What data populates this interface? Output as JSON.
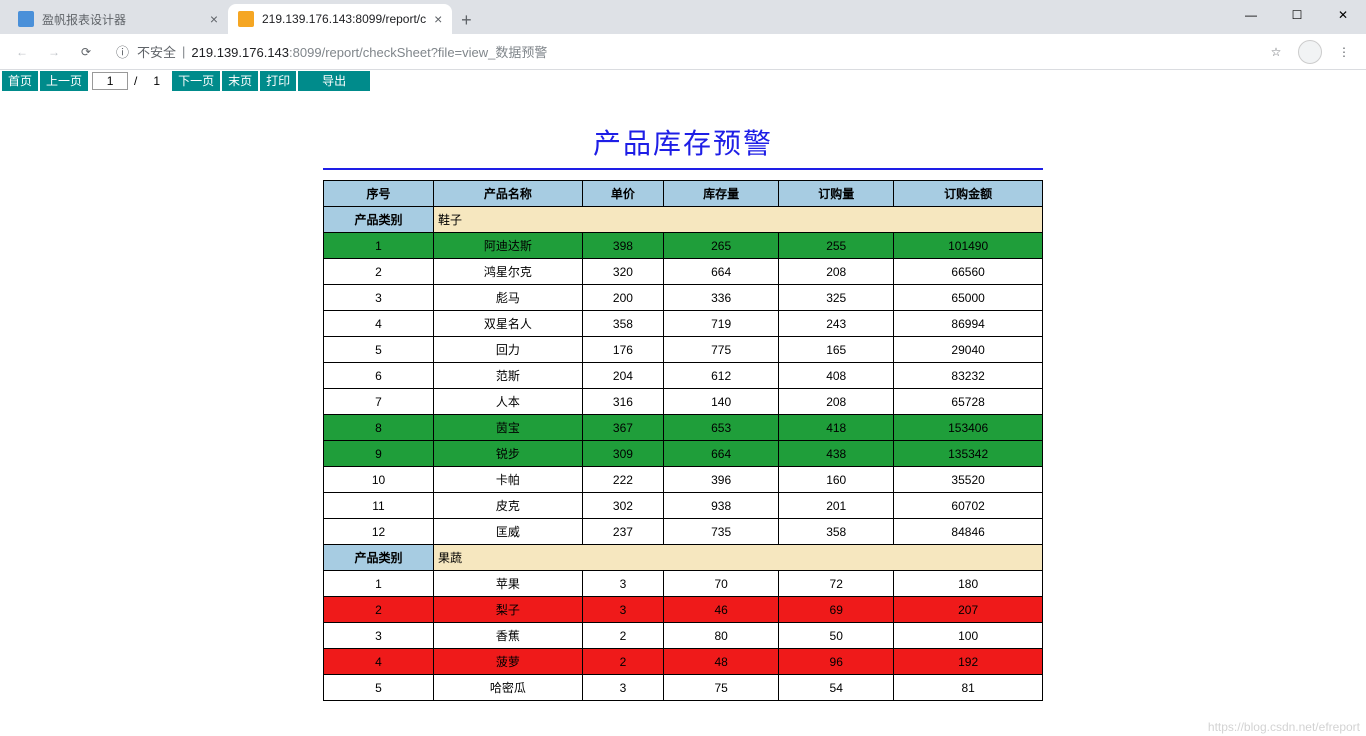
{
  "browser": {
    "tabs": [
      {
        "title": "盈帆报表设计器",
        "active": false
      },
      {
        "title": "219.139.176.143:8099/report/c",
        "active": true
      }
    ],
    "url_insecure_label": "不安全",
    "url_host": "219.139.176.143",
    "url_port": ":8099",
    "url_path": "/report/checkSheet?file=view_数据预警"
  },
  "toolbar": {
    "first": "首页",
    "prev": "上一页",
    "current_page": "1",
    "total_pages": "1",
    "next": "下一页",
    "last": "末页",
    "print": "打印",
    "export": "导出"
  },
  "report": {
    "title": "产品库存预警",
    "columns": [
      "序号",
      "产品名称",
      "单价",
      "库存量",
      "订购量",
      "订购金额"
    ],
    "category_label": "产品类别",
    "groups": [
      {
        "category": "鞋子",
        "rows": [
          {
            "seq": "1",
            "name": "阿迪达斯",
            "price": "398",
            "stock": "265",
            "order": "255",
            "amount": "101490",
            "hl": "green"
          },
          {
            "seq": "2",
            "name": "鸿星尔克",
            "price": "320",
            "stock": "664",
            "order": "208",
            "amount": "66560",
            "hl": ""
          },
          {
            "seq": "3",
            "name": "彪马",
            "price": "200",
            "stock": "336",
            "order": "325",
            "amount": "65000",
            "hl": ""
          },
          {
            "seq": "4",
            "name": "双星名人",
            "price": "358",
            "stock": "719",
            "order": "243",
            "amount": "86994",
            "hl": ""
          },
          {
            "seq": "5",
            "name": "回力",
            "price": "176",
            "stock": "775",
            "order": "165",
            "amount": "29040",
            "hl": ""
          },
          {
            "seq": "6",
            "name": "范斯",
            "price": "204",
            "stock": "612",
            "order": "408",
            "amount": "83232",
            "hl": ""
          },
          {
            "seq": "7",
            "name": "人本",
            "price": "316",
            "stock": "140",
            "order": "208",
            "amount": "65728",
            "hl": ""
          },
          {
            "seq": "8",
            "name": "茵宝",
            "price": "367",
            "stock": "653",
            "order": "418",
            "amount": "153406",
            "hl": "green"
          },
          {
            "seq": "9",
            "name": "锐步",
            "price": "309",
            "stock": "664",
            "order": "438",
            "amount": "135342",
            "hl": "green"
          },
          {
            "seq": "10",
            "name": "卡帕",
            "price": "222",
            "stock": "396",
            "order": "160",
            "amount": "35520",
            "hl": ""
          },
          {
            "seq": "11",
            "name": "皮克",
            "price": "302",
            "stock": "938",
            "order": "201",
            "amount": "60702",
            "hl": ""
          },
          {
            "seq": "12",
            "name": "匡威",
            "price": "237",
            "stock": "735",
            "order": "358",
            "amount": "84846",
            "hl": ""
          }
        ]
      },
      {
        "category": "果蔬",
        "rows": [
          {
            "seq": "1",
            "name": "苹果",
            "price": "3",
            "stock": "70",
            "order": "72",
            "amount": "180",
            "hl": ""
          },
          {
            "seq": "2",
            "name": "梨子",
            "price": "3",
            "stock": "46",
            "order": "69",
            "amount": "207",
            "hl": "red"
          },
          {
            "seq": "3",
            "name": "香蕉",
            "price": "2",
            "stock": "80",
            "order": "50",
            "amount": "100",
            "hl": ""
          },
          {
            "seq": "4",
            "name": "菠萝",
            "price": "2",
            "stock": "48",
            "order": "96",
            "amount": "192",
            "hl": "red"
          },
          {
            "seq": "5",
            "name": "哈密瓜",
            "price": "3",
            "stock": "75",
            "order": "54",
            "amount": "81",
            "hl": ""
          }
        ]
      }
    ]
  },
  "watermark": "https://blog.csdn.net/efreport"
}
